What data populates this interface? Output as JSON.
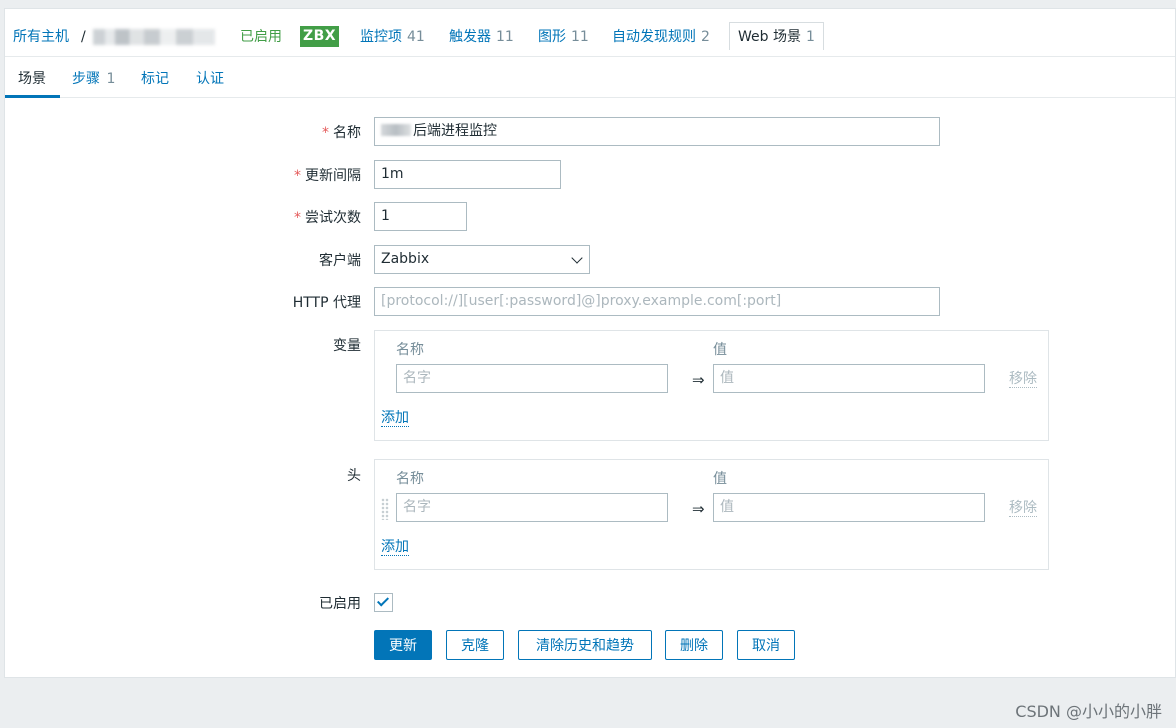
{
  "nav": {
    "all_hosts": "所有主机",
    "separator": "/",
    "status": "已启用",
    "zbx_badge": "ZBX",
    "items_label": "监控项",
    "items_count": "41",
    "triggers_label": "触发器",
    "triggers_count": "11",
    "graphs_label": "图形",
    "graphs_count": "11",
    "discovery_label": "自动发现规则",
    "discovery_count": "2",
    "web_label": "Web 场景",
    "web_count": "1"
  },
  "subtabs": {
    "scenario": "场景",
    "steps": "步骤",
    "steps_count": "1",
    "tags": "标记",
    "auth": "认证"
  },
  "form": {
    "required_mark": "*",
    "name_label": "名称",
    "name_value": "后端进程监控",
    "interval_label": "更新间隔",
    "interval_value": "1m",
    "attempts_label": "尝试次数",
    "attempts_value": "1",
    "agent_label": "客户端",
    "agent_value": "Zabbix",
    "proxy_label": "HTTP 代理",
    "proxy_placeholder": "[protocol://][user[:password]@]proxy.example.com[:port]",
    "variables_label": "变量",
    "headers_label": "头",
    "col_name": "名称",
    "col_value": "值",
    "name_placeholder": "名字",
    "value_placeholder": "值",
    "arrow": "⇒",
    "remove": "移除",
    "add": "添加",
    "enabled_label": "已启用",
    "enabled_checked": true
  },
  "buttons": {
    "update": "更新",
    "clone": "克隆",
    "clear_history": "清除历史和趋势",
    "delete": "删除",
    "cancel": "取消"
  },
  "watermark": "CSDN @小小的小胖",
  "colors": {
    "accent": "#0275b8",
    "enabled_green": "#429e47",
    "required_red": "#e45959",
    "background": "#ebeef0"
  }
}
